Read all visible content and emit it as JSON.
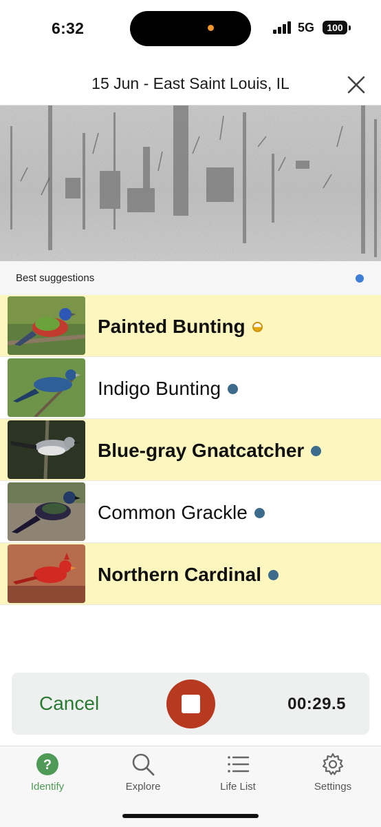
{
  "status": {
    "time": "6:32",
    "network": "5G",
    "battery": "100"
  },
  "header": {
    "title": "15 Jun - East Saint Louis, IL"
  },
  "suggestions": {
    "label": "Best suggestions",
    "items": [
      {
        "name": "Painted Bunting",
        "highlighted": true,
        "badge": "half-circle-icon"
      },
      {
        "name": "Indigo Bunting",
        "highlighted": false,
        "badge": "check-icon"
      },
      {
        "name": "Blue-gray Gnatcatcher",
        "highlighted": true,
        "badge": "check-icon"
      },
      {
        "name": "Common Grackle",
        "highlighted": false,
        "badge": "check-icon"
      },
      {
        "name": "Northern Cardinal",
        "highlighted": true,
        "badge": "check-icon"
      }
    ]
  },
  "recorder": {
    "cancel_label": "Cancel",
    "elapsed": "00:29.5"
  },
  "tabs": [
    {
      "label": "Identify",
      "icon": "question-circle-icon",
      "active": true
    },
    {
      "label": "Explore",
      "icon": "magnifier-icon",
      "active": false
    },
    {
      "label": "Life List",
      "icon": "list-icon",
      "active": false
    },
    {
      "label": "Settings",
      "icon": "gear-icon",
      "active": false
    }
  ],
  "colors": {
    "highlight": "#fdf6bf",
    "accent_green": "#4f9a56",
    "stop_red": "#b73a20",
    "verified_blue": "#3d6b8c",
    "live_dot": "#3f7ed8"
  }
}
